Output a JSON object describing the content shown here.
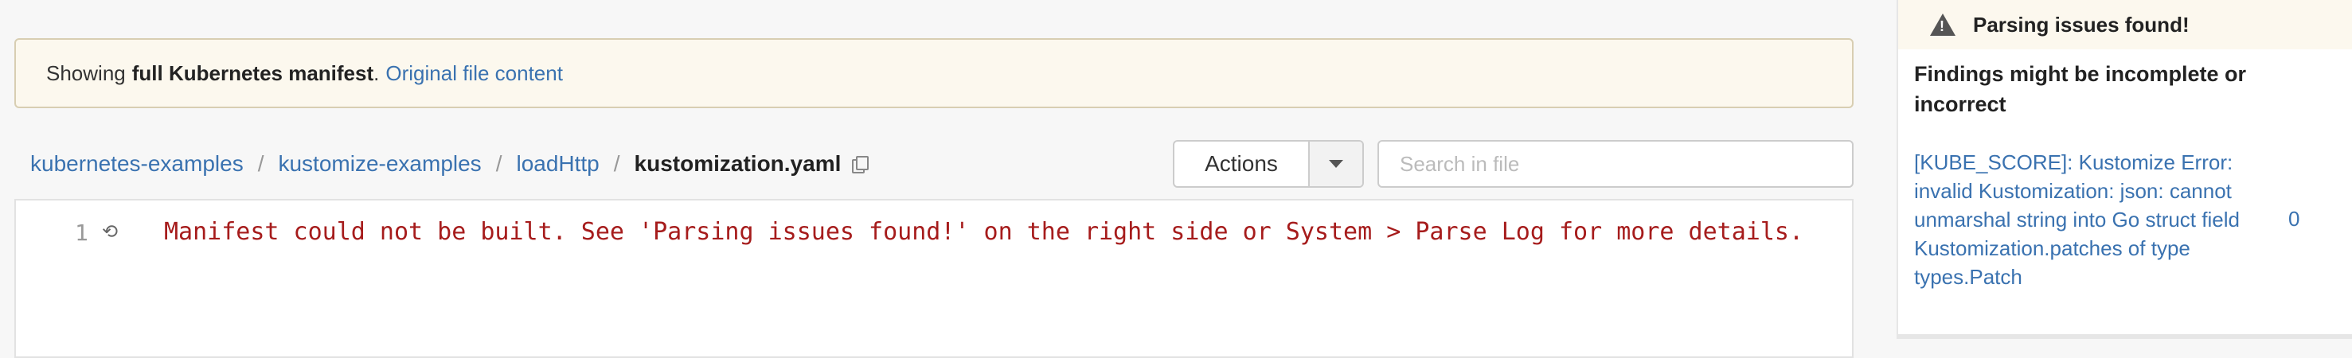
{
  "banner": {
    "prefix": "Showing",
    "bold": "full Kubernetes manifest",
    "suffix": ".",
    "link": "Original file content"
  },
  "breadcrumb": {
    "items": [
      "kubernetes-examples",
      "kustomize-examples",
      "loadHttp"
    ],
    "separator": "/",
    "file": "kustomization.yaml"
  },
  "toolbar": {
    "actions_label": "Actions",
    "search_placeholder": "Search in file"
  },
  "editor": {
    "line_number": "1",
    "line_text": "Manifest could not be built. See 'Parsing issues found!' on the right side or System > Parse Log for more details."
  },
  "sidebar": {
    "header": "Parsing issues found!",
    "subheader": "Findings might be incomplete or incorrect",
    "finding_text": "[KUBE_SCORE]: Kustomize Error: invalid Kustomization: json: cannot unmarshal string into Go struct field Kustomization.patches of type types.Patch",
    "finding_count": "0"
  },
  "icons": {
    "copy": "copy-icon",
    "history": "history-icon",
    "warning": "warning-icon",
    "caret": "chevron-down-icon"
  },
  "colors": {
    "link": "#3a72b0",
    "error_text": "#a61c1c",
    "banner_bg": "#fcf8ee"
  }
}
